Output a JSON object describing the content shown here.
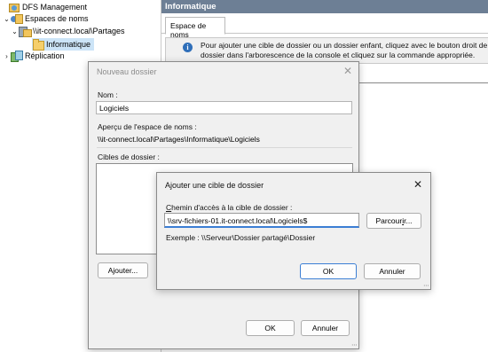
{
  "tree": {
    "items": [
      {
        "label": "DFS Management",
        "icon": "dfs-management-icon"
      },
      {
        "label": "Espaces de noms",
        "icon": "namespaces-icon"
      },
      {
        "label": "\\\\it-connect.local\\Partages",
        "icon": "namespace-root-icon"
      },
      {
        "label": "Informatique",
        "icon": "folder-icon"
      },
      {
        "label": "Réplication",
        "icon": "replication-icon"
      }
    ]
  },
  "right_pane": {
    "header": "Informatique",
    "tab": "Espace de noms",
    "info_line1": "Pour ajouter une cible de dossier ou un dossier enfant, cliquez avec le bouton droit de la",
    "info_line2": "dossier dans l'arborescence de la console et cliquez sur la commande appropriée."
  },
  "new_folder_dialog": {
    "title": "Nouveau dossier",
    "name_label": "Nom :",
    "name_value": "Logiciels",
    "preview_label": "Aperçu de l'espace de noms :",
    "preview_value": "\\\\it-connect.local\\Partages\\Informatique\\Logiciels",
    "targets_label": "Cibles de dossier :",
    "add_button": "Ajouter...",
    "ok_button": "OK",
    "cancel_button": "Annuler"
  },
  "add_target_dialog": {
    "title": "Ajouter une cible de dossier",
    "path_label_accel": "C",
    "path_label_rest": "hemin d'accès à la cible de dossier :",
    "path_value": "\\\\srv-fichiers-01.it-connect.local\\Logiciels$",
    "browse_button_prefix": "Parcour",
    "browse_button_accel": "i",
    "browse_button_suffix": "r...",
    "example_text": "Exemple : \\\\Serveur\\Dossier partagé\\Dossier",
    "ok_button": "OK",
    "cancel_button": "Annuler"
  }
}
